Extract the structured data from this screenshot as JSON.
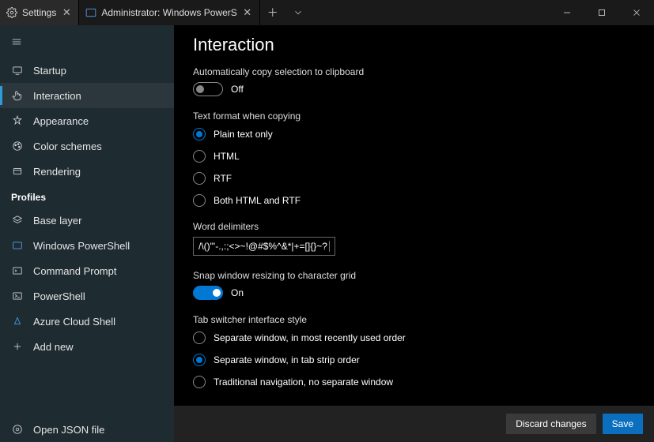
{
  "titlebar": {
    "tabs": [
      {
        "label": "Settings"
      },
      {
        "label": "Administrator: Windows PowerS"
      }
    ]
  },
  "sidebar": {
    "items": [
      {
        "label": "Startup"
      },
      {
        "label": "Interaction"
      },
      {
        "label": "Appearance"
      },
      {
        "label": "Color schemes"
      },
      {
        "label": "Rendering"
      }
    ],
    "profiles_header": "Profiles",
    "profiles": [
      {
        "label": "Base layer"
      },
      {
        "label": "Windows PowerShell"
      },
      {
        "label": "Command Prompt"
      },
      {
        "label": "PowerShell"
      },
      {
        "label": "Azure Cloud Shell"
      },
      {
        "label": "Add new"
      }
    ],
    "footer": {
      "label": "Open JSON file"
    }
  },
  "main": {
    "title": "Interaction",
    "auto_copy": {
      "label": "Automatically copy selection to clipboard",
      "state": "Off"
    },
    "text_format": {
      "label": "Text format when copying",
      "options": [
        "Plain text only",
        "HTML",
        "RTF",
        "Both HTML and RTF"
      ]
    },
    "word_delim": {
      "label": "Word delimiters",
      "value": "/\\()\"'-.,:;<>~!@#$%^&*|+=[]{}~?│"
    },
    "snap": {
      "label": "Snap window resizing to character grid",
      "state": "On"
    },
    "tab_switcher": {
      "label": "Tab switcher interface style",
      "options": [
        "Separate window, in most recently used order",
        "Separate window, in tab strip order",
        "Traditional navigation, no separate window"
      ]
    }
  },
  "bottombar": {
    "discard": "Discard changes",
    "save": "Save"
  }
}
